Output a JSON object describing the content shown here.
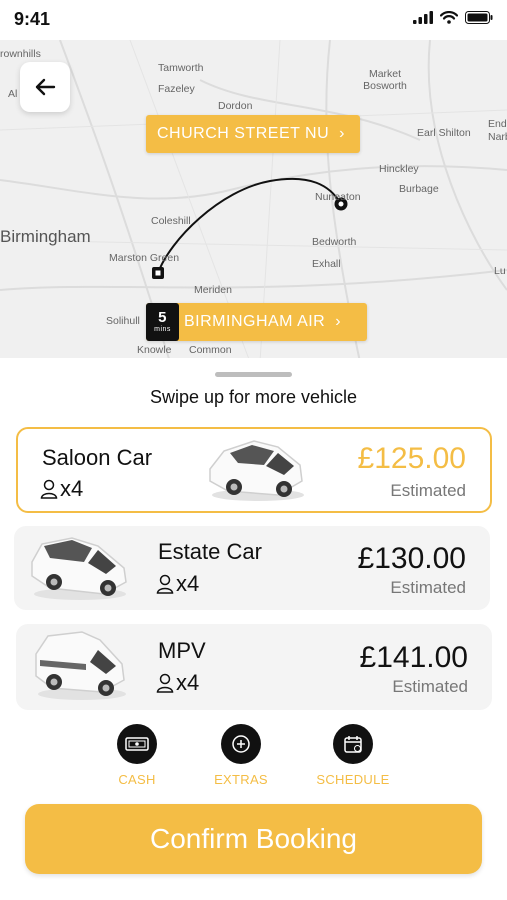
{
  "status_bar": {
    "time": "9:41"
  },
  "map": {
    "towns": [
      "rownhills",
      "Al",
      "Tamworth",
      "Fazeley",
      "Dordon",
      "Market Bosworth",
      "Earl Shilton",
      "End",
      "Narb",
      "Hinckley",
      "Burbage",
      "Nuneaton",
      "Coleshill",
      "Birmingham",
      "Marston Green",
      "Bedworth",
      "Exhall",
      "Meriden",
      "Solihull",
      "Knowle",
      "Common",
      "Lu"
    ],
    "pickup": {
      "label": "CHURCH STREET NU"
    },
    "dropoff": {
      "label": "BIRMINGHAM AIR",
      "eta_value": "5",
      "eta_unit": "mins"
    }
  },
  "sheet": {
    "swipe_hint": "Swipe up for more vehicle",
    "vehicles": [
      {
        "name": "Saloon Car",
        "capacity": "x4",
        "price": "£125.00",
        "estimate": "Estimated",
        "selected": true
      },
      {
        "name": "Estate Car",
        "capacity": "x4",
        "price": "£130.00",
        "estimate": "Estimated",
        "selected": false
      },
      {
        "name": "MPV",
        "capacity": "x4",
        "price": "£141.00",
        "estimate": "Estimated",
        "selected": false
      }
    ],
    "options": [
      {
        "label": "CASH",
        "icon": "cash-icon"
      },
      {
        "label": "EXTRAS",
        "icon": "plus-icon"
      },
      {
        "label": "SCHEDULE",
        "icon": "calendar-icon"
      }
    ],
    "confirm_label": "Confirm Booking"
  },
  "colors": {
    "accent": "#f4bd45",
    "card": "#f4f4f4",
    "map": "#f0f0f0"
  }
}
